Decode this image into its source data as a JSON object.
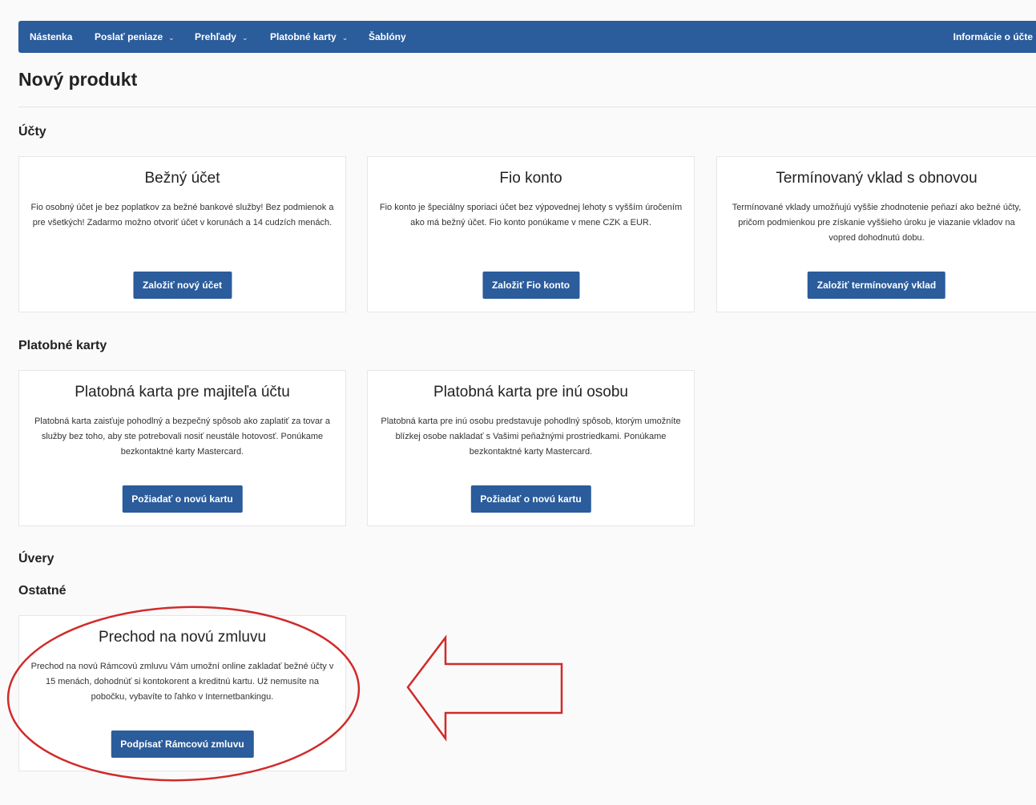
{
  "nav": {
    "items": [
      {
        "label": "Nástenka",
        "caret": false
      },
      {
        "label": "Poslať peniaze",
        "caret": true
      },
      {
        "label": "Prehľady",
        "caret": true
      },
      {
        "label": "Platobné karty",
        "caret": true
      },
      {
        "label": "Šablóny",
        "caret": false
      }
    ],
    "right_label": "Informácie o účte",
    "caret_glyph": "⌄"
  },
  "page_title": "Nový produkt",
  "sections": {
    "accounts": {
      "title": "Účty",
      "cards": [
        {
          "title": "Bežný účet",
          "text": "Fio osobný účet je bez poplatkov za bežné bankové služby! Bez podmienok a pre všetkých! Zadarmo možno otvoriť účet v korunách a 14 cudzích menách.",
          "button": "Založiť nový účet"
        },
        {
          "title": "Fio konto",
          "text": "Fio konto je špeciálny sporiaci účet bez výpovednej lehoty s vyšším úročením ako má bežný účet. Fio konto ponúkame v mene CZK a EUR.",
          "button": "Založiť Fio konto"
        },
        {
          "title": "Termínovaný vklad s obnovou",
          "text": "Termínované vklady umožňujú vyššie zhodnotenie peňazí ako bežné účty, pričom podmienkou pre získanie vyššieho úroku je viazanie vkladov na vopred dohodnutú dobu.",
          "button": "Založiť termínovaný vklad"
        }
      ]
    },
    "cards": {
      "title": "Platobné karty",
      "cards": [
        {
          "title": "Platobná karta pre majiteľa účtu",
          "text": "Platobná karta zaisťuje pohodlný a bezpečný spôsob ako zaplatiť za tovar a služby bez toho, aby ste potrebovali nosiť neustále hotovosť. Ponúkame bezkontaktné karty Mastercard.",
          "button": "Požiadať o novú kartu"
        },
        {
          "title": "Platobná karta pre inú osobu",
          "text": "Platobná karta pre inú osobu predstavuje pohodlný spôsob, ktorým umožníte blízkej osobe nakladať s Vašimi peňažnými prostriedkami. Ponúkame bezkontaktné karty Mastercard.",
          "button": "Požiadať o novú kartu"
        }
      ]
    },
    "loans": {
      "title": "Úvery"
    },
    "other": {
      "title": "Ostatné",
      "cards": [
        {
          "title": "Prechod na novú zmluvu",
          "text": "Prechod na novú Rámcovú zmluvu Vám umožní online zakladať bežné účty v 15 menách, dohodnúť si kontokorent a kreditnú kartu. Už nemusíte na pobočku, vybavíte to ľahko v Internetbankingu.",
          "button": "Podpísať Rámcovú zmluvu"
        }
      ]
    }
  },
  "colors": {
    "primary": "#2b5c9b",
    "annotation": "#d12a2a",
    "background": "#fafafa"
  },
  "icons": {
    "annotation_shapes": [
      "highlight-ellipse",
      "pointing-arrow"
    ]
  }
}
